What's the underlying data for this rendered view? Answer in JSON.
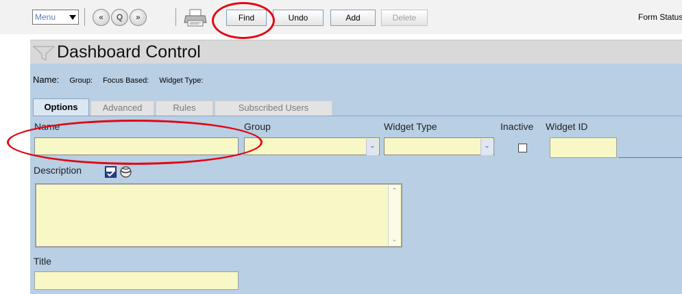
{
  "toolbar": {
    "menu_label": "Menu",
    "nav_prev_glyph": "«",
    "nav_search_glyph": "Q",
    "nav_next_glyph": "»",
    "find_label": "Find",
    "undo_label": "Undo",
    "add_label": "Add",
    "delete_label": "Delete",
    "form_status_label": "Form Status"
  },
  "header": {
    "title": "Dashboard Control"
  },
  "info": {
    "name_label": "Name:",
    "group_label": "Group:",
    "focus_label": "Focus Based:",
    "widget_type_label": "Widget Type:"
  },
  "tabs": [
    {
      "label": "Options",
      "active": true
    },
    {
      "label": "Advanced",
      "active": false
    },
    {
      "label": "Rules",
      "active": false
    },
    {
      "label": "Subscribed Users",
      "active": false
    }
  ],
  "fields": {
    "name_label": "Name",
    "name_value": "",
    "group_label": "Group",
    "group_value": "",
    "widget_type_label": "Widget Type",
    "widget_type_value": "",
    "inactive_label": "Inactive",
    "inactive_checked": false,
    "widget_id_label": "Widget ID",
    "widget_id_value": "",
    "description_label": "Description",
    "description_value": "",
    "title_label": "Title",
    "title_value": ""
  },
  "colors": {
    "form_background": "#b8cfe4",
    "field_background": "#f8f8c6",
    "annotation": "#e30613"
  },
  "icons": [
    "menu-caret-icon",
    "previous-icon",
    "search-icon",
    "next-icon",
    "printer-icon",
    "funnel-icon",
    "spellcheck-icon",
    "lookup-ball-icon",
    "chevron-down-icon"
  ]
}
